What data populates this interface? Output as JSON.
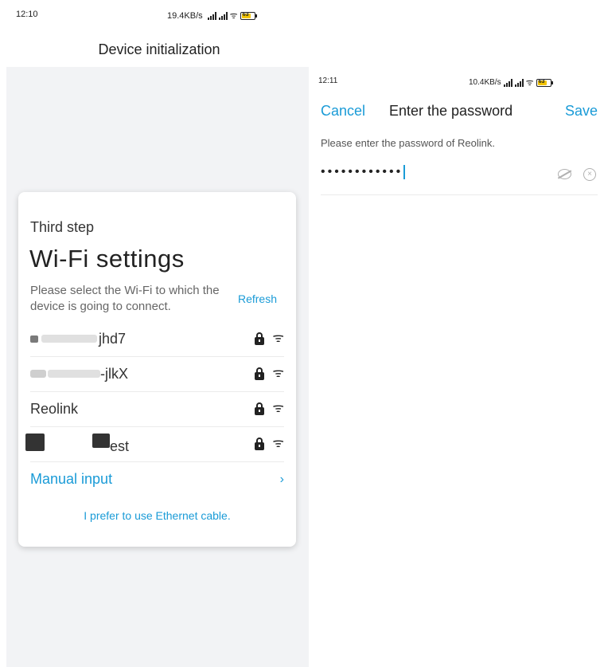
{
  "left": {
    "status": {
      "time": "12:10",
      "speed": "19.4KB/s",
      "battery": "63"
    },
    "title": "Device initialization",
    "card": {
      "step": "Third step",
      "heading": "Wi-Fi settings",
      "description": "Please select the Wi-Fi to which the device is going to connect.",
      "refresh": "Refresh",
      "networks": [
        {
          "name": "jhd7",
          "secured": true
        },
        {
          "name": "-jlkX",
          "secured": true
        },
        {
          "name": "Reolink",
          "secured": true
        },
        {
          "name": "est",
          "secured": true
        }
      ],
      "manual_input": "Manual input",
      "ethernet": "I prefer to use Ethernet cable."
    }
  },
  "right": {
    "status": {
      "time": "12:11",
      "speed": "10.4KB/s",
      "battery": "63"
    },
    "cancel": "Cancel",
    "title": "Enter the password",
    "save": "Save",
    "hint": "Please enter the password of Reolink.",
    "password_mask": "••••••••••••"
  },
  "colors": {
    "accent": "#1a9bd7",
    "background": "#f2f3f5"
  },
  "icons": [
    "lock-icon",
    "wifi-icon",
    "chevron-right-icon",
    "eye-hidden-icon",
    "clear-icon",
    "battery-icon",
    "signal-icon"
  ]
}
